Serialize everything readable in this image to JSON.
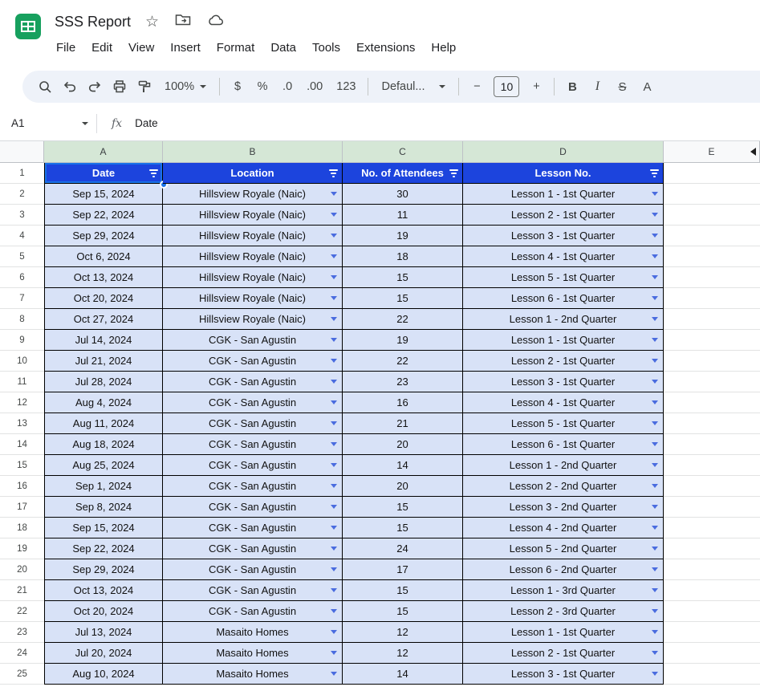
{
  "doc": {
    "title": "SSS Report"
  },
  "menus": [
    "File",
    "Edit",
    "View",
    "Insert",
    "Format",
    "Data",
    "Tools",
    "Extensions",
    "Help"
  ],
  "toolbar": {
    "zoom": "100%",
    "currency": "$",
    "percent": "%",
    "decrease_decimal": ".0",
    "increase_decimal": ".00",
    "more_formats": "123",
    "font": "Defaul...",
    "decrease_font": "−",
    "font_size": "10",
    "increase_font": "+",
    "bold": "B",
    "italic": "I",
    "strikethrough": "S",
    "text_color": "A"
  },
  "formula_bar": {
    "cell_ref": "A1",
    "value": "Date"
  },
  "grid": {
    "columns": [
      "A",
      "B",
      "C",
      "D",
      "E"
    ],
    "headers": [
      "Date",
      "Location",
      "No. of Attendees",
      "Lesson No."
    ],
    "header_row_n": "1",
    "active_cell": "A1",
    "rows": [
      {
        "n": 2,
        "date": "Sep 15, 2024",
        "location": "Hillsview Royale (Naic)",
        "attendees": "30",
        "lesson": "Lesson 1 - 1st Quarter"
      },
      {
        "n": 3,
        "date": "Sep 22, 2024",
        "location": "Hillsview Royale (Naic)",
        "attendees": "11",
        "lesson": "Lesson 2 - 1st Quarter"
      },
      {
        "n": 4,
        "date": "Sep 29, 2024",
        "location": "Hillsview Royale (Naic)",
        "attendees": "19",
        "lesson": "Lesson 3 - 1st Quarter"
      },
      {
        "n": 5,
        "date": "Oct 6, 2024",
        "location": "Hillsview Royale (Naic)",
        "attendees": "18",
        "lesson": "Lesson 4 - 1st Quarter"
      },
      {
        "n": 6,
        "date": "Oct 13, 2024",
        "location": "Hillsview Royale (Naic)",
        "attendees": "15",
        "lesson": "Lesson 5 - 1st Quarter"
      },
      {
        "n": 7,
        "date": "Oct 20, 2024",
        "location": "Hillsview Royale (Naic)",
        "attendees": "15",
        "lesson": "Lesson 6 - 1st Quarter"
      },
      {
        "n": 8,
        "date": "Oct 27, 2024",
        "location": "Hillsview Royale (Naic)",
        "attendees": "22",
        "lesson": "Lesson 1 - 2nd Quarter"
      },
      {
        "n": 9,
        "date": "Jul 14, 2024",
        "location": "CGK - San Agustin",
        "attendees": "19",
        "lesson": "Lesson 1 - 1st Quarter"
      },
      {
        "n": 10,
        "date": "Jul 21, 2024",
        "location": "CGK - San Agustin",
        "attendees": "22",
        "lesson": "Lesson 2 - 1st Quarter"
      },
      {
        "n": 11,
        "date": "Jul 28, 2024",
        "location": "CGK - San Agustin",
        "attendees": "23",
        "lesson": "Lesson 3 - 1st Quarter"
      },
      {
        "n": 12,
        "date": "Aug 4, 2024",
        "location": "CGK - San Agustin",
        "attendees": "16",
        "lesson": "Lesson 4 - 1st Quarter"
      },
      {
        "n": 13,
        "date": "Aug 11, 2024",
        "location": "CGK - San Agustin",
        "attendees": "21",
        "lesson": "Lesson 5 - 1st Quarter"
      },
      {
        "n": 14,
        "date": "Aug 18, 2024",
        "location": "CGK - San Agustin",
        "attendees": "20",
        "lesson": "Lesson 6 - 1st Quarter"
      },
      {
        "n": 15,
        "date": "Aug 25, 2024",
        "location": "CGK - San Agustin",
        "attendees": "14",
        "lesson": "Lesson 1 - 2nd Quarter"
      },
      {
        "n": 16,
        "date": "Sep 1, 2024",
        "location": "CGK - San Agustin",
        "attendees": "20",
        "lesson": "Lesson 2 - 2nd Quarter"
      },
      {
        "n": 17,
        "date": "Sep 8, 2024",
        "location": "CGK - San Agustin",
        "attendees": "15",
        "lesson": "Lesson 3 - 2nd Quarter"
      },
      {
        "n": 18,
        "date": "Sep 15, 2024",
        "location": "CGK - San Agustin",
        "attendees": "15",
        "lesson": "Lesson 4 - 2nd Quarter"
      },
      {
        "n": 19,
        "date": "Sep 22, 2024",
        "location": "CGK - San Agustin",
        "attendees": "24",
        "lesson": "Lesson 5 - 2nd Quarter"
      },
      {
        "n": 20,
        "date": "Sep 29, 2024",
        "location": "CGK - San Agustin",
        "attendees": "17",
        "lesson": "Lesson 6 - 2nd Quarter"
      },
      {
        "n": 21,
        "date": "Oct 13, 2024",
        "location": "CGK - San Agustin",
        "attendees": "15",
        "lesson": "Lesson 1 - 3rd Quarter"
      },
      {
        "n": 22,
        "date": "Oct 20, 2024",
        "location": "CGK - San Agustin",
        "attendees": "15",
        "lesson": "Lesson 2 - 3rd Quarter"
      },
      {
        "n": 23,
        "date": "Jul 13, 2024",
        "location": "Masaito Homes",
        "attendees": "12",
        "lesson": "Lesson 1 - 1st Quarter"
      },
      {
        "n": 24,
        "date": "Jul 20, 2024",
        "location": "Masaito Homes",
        "attendees": "12",
        "lesson": "Lesson 2 - 1st Quarter"
      },
      {
        "n": 25,
        "date": "Aug 10, 2024",
        "location": "Masaito Homes",
        "attendees": "14",
        "lesson": "Lesson 3 - 1st Quarter"
      }
    ]
  },
  "colors": {
    "header_bg": "#1c44dd",
    "cell_bg": "#d8e2f7",
    "chevron": "#4a6cdf",
    "accent": "#1a73e8",
    "col_green": "#d5e7d6",
    "logo_green": "#17a05e"
  }
}
